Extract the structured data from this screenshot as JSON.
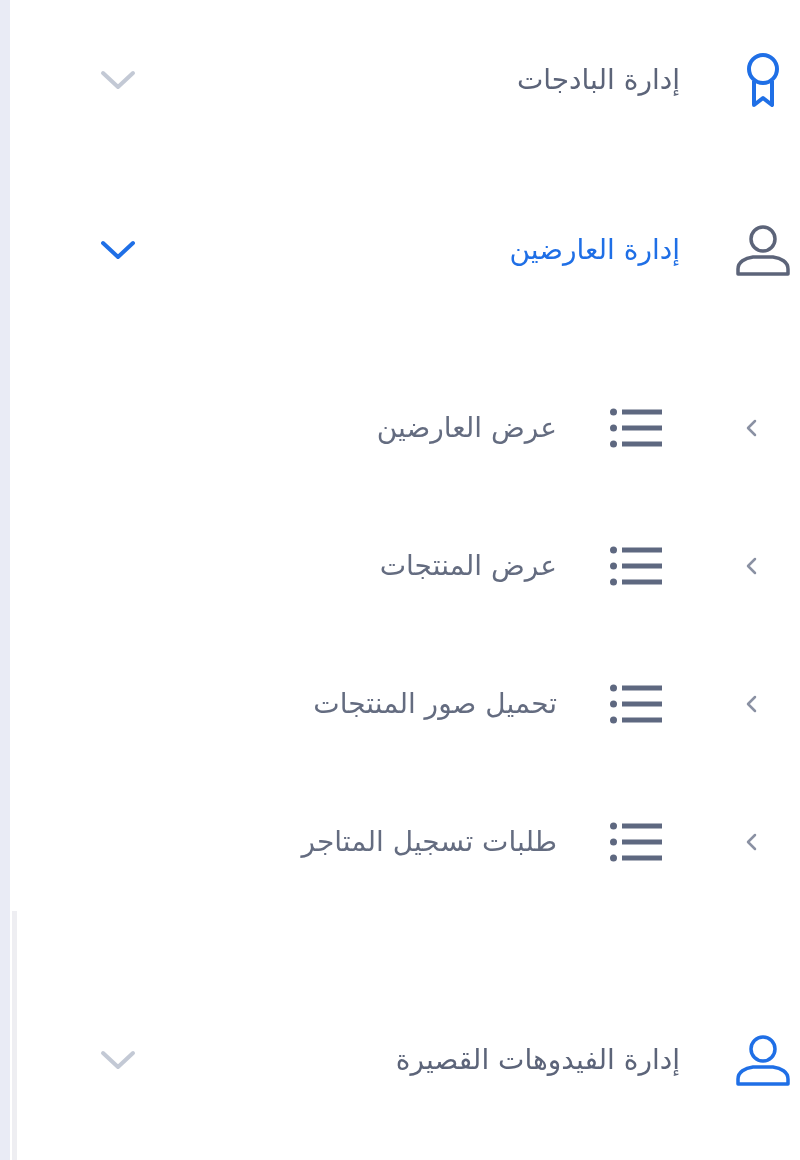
{
  "menu": [
    {
      "kind": "award",
      "label": "إدارة البادجات",
      "expanded": false,
      "icon_highlighted": true
    },
    {
      "kind": "user",
      "label": "إدارة العارضين",
      "expanded": true,
      "icon_highlighted": false,
      "children": [
        {
          "label": "عرض العارضين"
        },
        {
          "label": "عرض المنتجات"
        },
        {
          "label": "تحميل صور المنتجات"
        },
        {
          "label": "طلبات تسجيل المتاجر"
        }
      ]
    },
    {
      "kind": "user",
      "label": "إدارة الفيدوهات القصيرة",
      "expanded": false,
      "icon_highlighted": true
    }
  ]
}
